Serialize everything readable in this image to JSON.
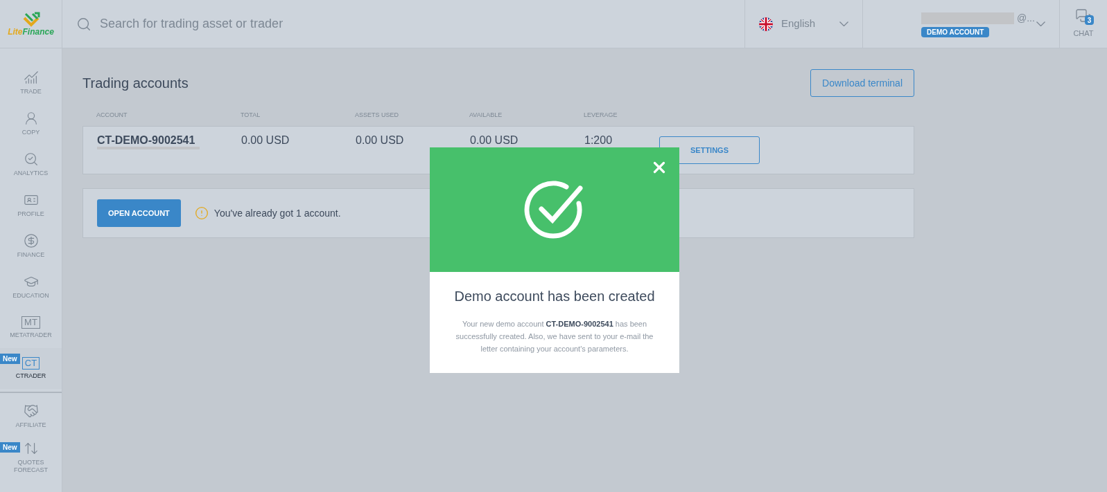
{
  "logo": {
    "first": "Lite",
    "second": "Finance"
  },
  "search": {
    "placeholder": "Search for trading asset or trader"
  },
  "language": {
    "label": "English"
  },
  "user": {
    "email_suffix": "@...",
    "badge": "DEMO ACCOUNT"
  },
  "chat": {
    "label": "CHAT",
    "count": "3"
  },
  "sidebar": {
    "items": [
      {
        "kind": "trade",
        "label": "TRADE",
        "selected": false
      },
      {
        "kind": "copy",
        "label": "COPY",
        "selected": false
      },
      {
        "kind": "analytics",
        "label": "ANALYTICS",
        "selected": false
      },
      {
        "kind": "profile",
        "label": "PROFILE",
        "selected": false
      },
      {
        "kind": "finance",
        "label": "FINANCE",
        "selected": false
      },
      {
        "kind": "education",
        "label": "EDUCATION",
        "selected": false
      },
      {
        "kind": "text",
        "icon_text": "MT",
        "label": "METATRADER",
        "selected": false
      },
      {
        "kind": "text",
        "icon_text": "CT",
        "label": "CTRADER",
        "badge": "New",
        "selected": true
      },
      {
        "kind": "affiliate",
        "label": "AFFILIATE",
        "selected": false,
        "divider_before": true
      },
      {
        "kind": "quotes",
        "label": "QUOTES FORECAST",
        "badge": "New",
        "selected": false
      }
    ]
  },
  "page": {
    "title": "Trading accounts",
    "download_button": "Download terminal",
    "table": {
      "columns": [
        "ACCOUNT",
        "TOTAL",
        "ASSETS USED",
        "AVAILABLE",
        "LEVERAGE"
      ],
      "rows": [
        {
          "cells": [
            "CT-DEMO-9002541",
            "0.00 USD",
            "0.00 USD",
            "0.00 USD",
            "1:200"
          ],
          "action": "SETTINGS"
        }
      ]
    },
    "open_account_button": "OPEN ACCOUNT",
    "notice": "You've already got 1 account."
  },
  "modal": {
    "title": "Demo account has been created",
    "message": "Your new demo account **CT-DEMO-9002541** has been successfully created. Also, we have sent to your e-mail the letter containing your account's parameters."
  }
}
